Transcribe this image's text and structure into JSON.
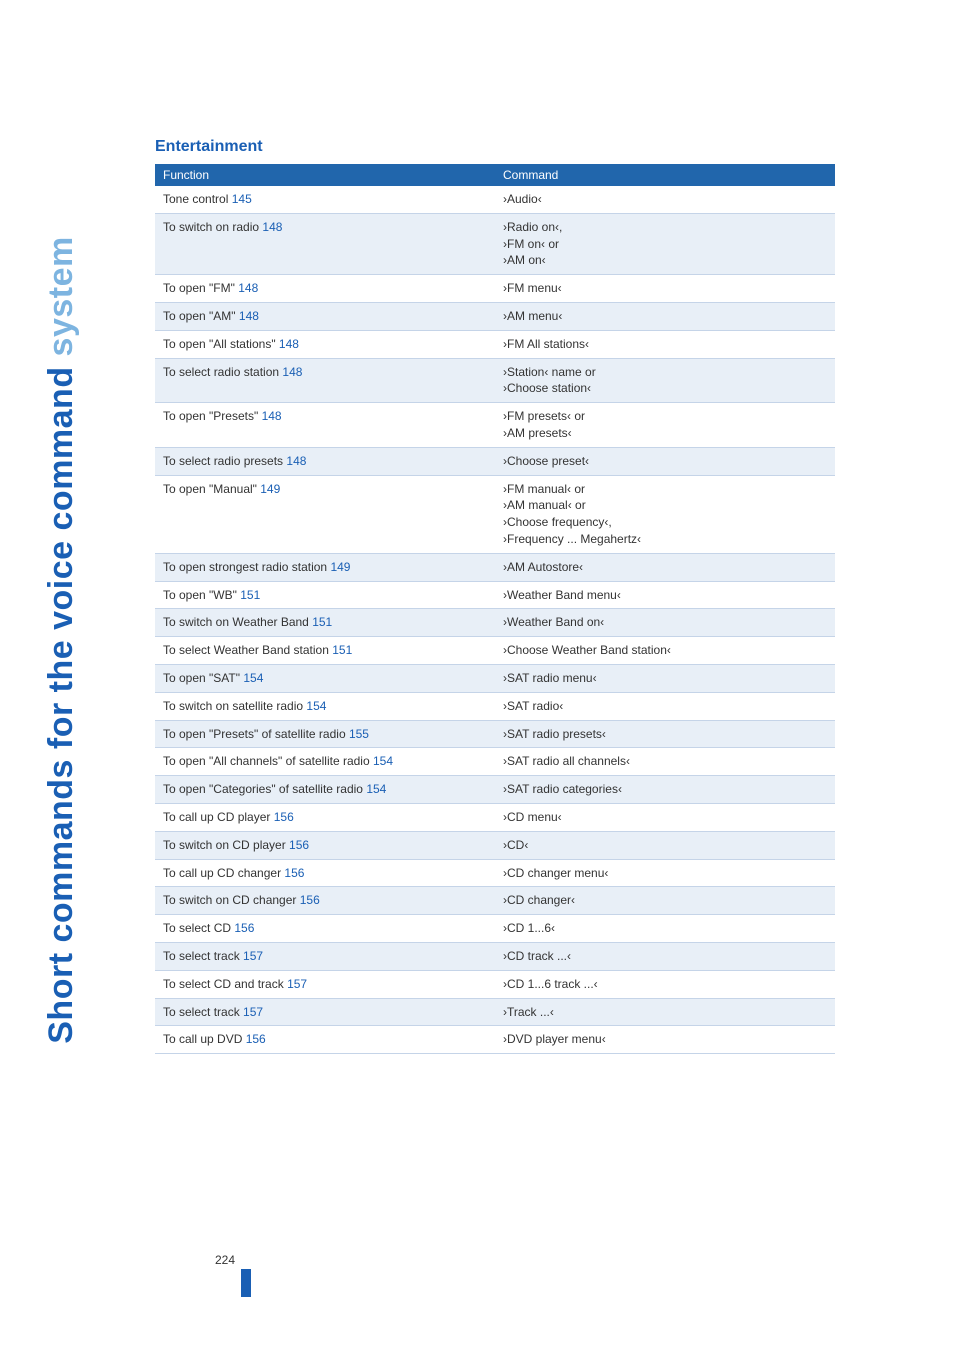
{
  "sidebar": {
    "text_blue": "Short commands for the voice command ",
    "text_light": "system"
  },
  "heading": "Entertainment",
  "table": {
    "header": {
      "col1": "Function",
      "col2": "Command"
    },
    "rows": [
      {
        "func": "Tone control",
        "ref": "145",
        "cmd": "›Audio‹"
      },
      {
        "func": "To switch on radio",
        "ref": "148",
        "cmd": "›Radio on‹,\n›FM on‹ or\n›AM on‹"
      },
      {
        "func": "To open \"FM\"",
        "ref": "148",
        "cmd": "›FM menu‹"
      },
      {
        "func": "To open \"AM\"",
        "ref": "148",
        "cmd": "›AM menu‹"
      },
      {
        "func": "To open \"All stations\"",
        "ref": "148",
        "cmd": "›FM All stations‹"
      },
      {
        "func": "To select radio station",
        "ref": "148",
        "cmd": "›Station‹ name or\n›Choose station‹"
      },
      {
        "func": "To open \"Presets\"",
        "ref": "148",
        "cmd": "›FM presets‹ or\n›AM presets‹"
      },
      {
        "func": "To select radio presets",
        "ref": "148",
        "cmd": "›Choose preset‹"
      },
      {
        "func": "To open \"Manual\"",
        "ref": "149",
        "cmd": "›FM manual‹ or\n›AM manual‹ or\n›Choose frequency‹,\n›Frequency ... Megahertz‹"
      },
      {
        "func": "To open strongest radio station",
        "ref": "149",
        "cmd": "›AM Autostore‹"
      },
      {
        "func": "To open \"WB\"",
        "ref": "151",
        "cmd": "›Weather Band menu‹"
      },
      {
        "func": "To switch on Weather Band",
        "ref": "151",
        "cmd": "›Weather Band on‹"
      },
      {
        "func": "To select Weather Band station",
        "ref": "151",
        "cmd": "›Choose Weather Band station‹"
      },
      {
        "func": "To open \"SAT\"",
        "ref": "154",
        "cmd": "›SAT radio menu‹"
      },
      {
        "func": "To switch on satellite radio",
        "ref": "154",
        "cmd": "›SAT radio‹"
      },
      {
        "func": "To open \"Presets\" of satellite radio",
        "ref": "155",
        "cmd": "›SAT radio presets‹"
      },
      {
        "func": "To open \"All channels\" of satellite radio",
        "ref": "154",
        "cmd": "›SAT radio all channels‹"
      },
      {
        "func": "To open \"Categories\" of satellite radio",
        "ref": "154",
        "cmd": "›SAT radio categories‹"
      },
      {
        "func": "To call up CD player",
        "ref": "156",
        "cmd": "›CD menu‹"
      },
      {
        "func": "To switch on CD player",
        "ref": "156",
        "cmd": "›CD‹"
      },
      {
        "func": "To call up CD changer",
        "ref": "156",
        "cmd": "›CD changer menu‹"
      },
      {
        "func": "To switch on CD changer",
        "ref": "156",
        "cmd": "›CD changer‹"
      },
      {
        "func": "To select CD",
        "ref": "156",
        "cmd": "›CD 1...6‹"
      },
      {
        "func": "To select track",
        "ref": "157",
        "cmd": "›CD track ...‹"
      },
      {
        "func": "To select CD and track",
        "ref": "157",
        "cmd": "›CD 1...6 track ...‹"
      },
      {
        "func": "To select track",
        "ref": "157",
        "cmd": "›Track ...‹"
      },
      {
        "func": "To call up DVD",
        "ref": "156",
        "cmd": "›DVD player menu‹"
      }
    ]
  },
  "page_number": "224"
}
